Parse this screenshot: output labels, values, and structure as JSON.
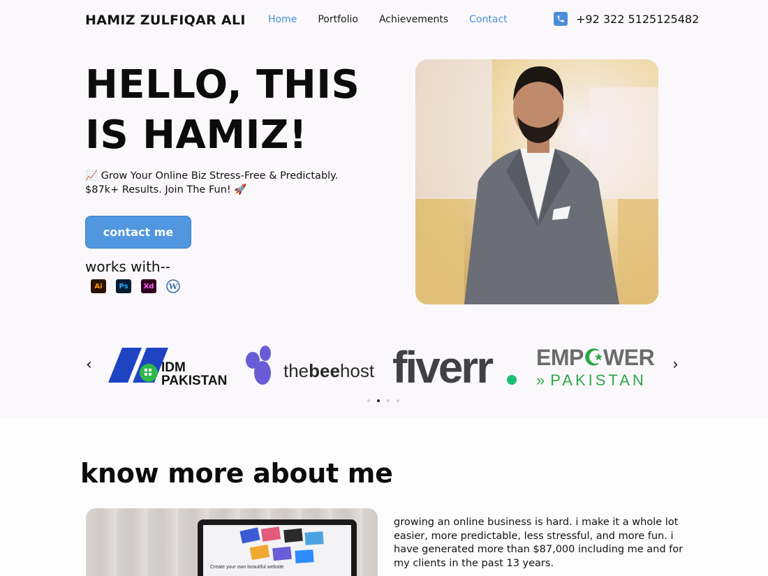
{
  "nav": {
    "brand": "HAMIZ ZULFIQAR ALI",
    "links": [
      {
        "label": "Home",
        "active": true
      },
      {
        "label": "Portfolio",
        "active": false
      },
      {
        "label": "Achievements",
        "active": false
      },
      {
        "label": "Contact",
        "active": true
      }
    ],
    "phone": "+92 322 5125125482"
  },
  "hero": {
    "title": "HELLO, THIS IS HAMIZ!",
    "tagline_line1": "📈 Grow Your Online Biz Stress-Free & Predictably.",
    "tagline_line2": "$87k+ Results. Join The Fun! 🚀",
    "cta_label": "contact me",
    "works_with": "works with--",
    "tools": [
      "Ai",
      "Ps",
      "Xd",
      "W"
    ]
  },
  "partners": {
    "logos": [
      {
        "name": "IDM PAKISTAN",
        "line1": "IDM",
        "line2": "PAKISTAN"
      },
      {
        "name": "thebeehost",
        "text_pre": "the",
        "text_bold": "bee",
        "text_post": "host"
      },
      {
        "name": "fiverr.",
        "text": "fiverr"
      },
      {
        "name": "EMPOWER PAKISTAN",
        "line1_a": "EMP",
        "line1_b": "WER",
        "line2": "PAKISTAN"
      }
    ],
    "prev_arrow": "‹",
    "next_arrow": "›",
    "active_dot": 1,
    "dot_count": 4
  },
  "about": {
    "title": "know more about me",
    "text": "growing an online business is hard. i make it a whole lot easier, more predictable, less stressful, and more fun. i have generated more than $87,000 including me and for my clients in the past 13 years.",
    "screen_caption": "Create your own beautiful website"
  },
  "colors": {
    "accent": "#4a8fd6",
    "cta": "#5197e0",
    "idm_blue": "#1e44c4",
    "idm_green": "#2fb84b",
    "bee_purple": "#6a5bd6",
    "fiverr_dark": "#404145",
    "fiverr_green": "#1dbf73",
    "empower_gray": "#6b6b6b",
    "empower_green": "#2aa84a"
  }
}
